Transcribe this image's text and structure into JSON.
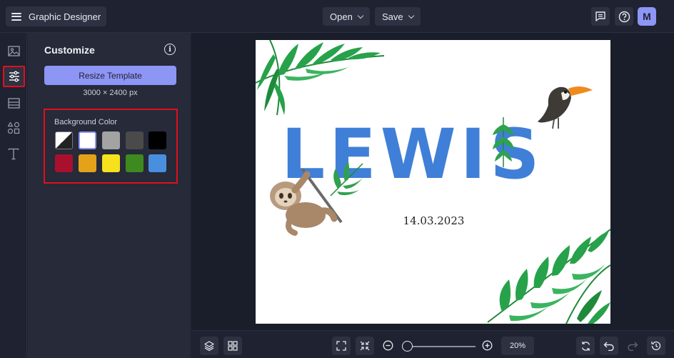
{
  "app": {
    "title": "Graphic Designer"
  },
  "topbar": {
    "open_label": "Open",
    "save_label": "Save",
    "avatar_initial": "M"
  },
  "sidebar": {
    "items": [
      {
        "icon": "image-icon"
      },
      {
        "icon": "sliders-icon",
        "active": true
      },
      {
        "icon": "layout-icon"
      },
      {
        "icon": "shapes-icon"
      },
      {
        "icon": "text-icon"
      }
    ]
  },
  "customize": {
    "title": "Customize",
    "resize_label": "Resize Template",
    "dimensions": "3000 × 2400 px",
    "background_label": "Background Color",
    "swatches": [
      "#ffffff",
      "#ffffff",
      "#a3a3a3",
      "#4a4a4a",
      "#000000",
      "#a8102e",
      "#e3a21a",
      "#f5e11c",
      "#3f8a1f",
      "#4a8fdf"
    ],
    "selected_swatch": 1
  },
  "canvas": {
    "name": "LEWIS",
    "date": "14.03.2023"
  },
  "bottombar": {
    "zoom": "20%"
  },
  "colors": {
    "accent": "#8d95f5",
    "highlight": "#e0101c",
    "panel": "#262a39",
    "background": "#1f2230"
  }
}
